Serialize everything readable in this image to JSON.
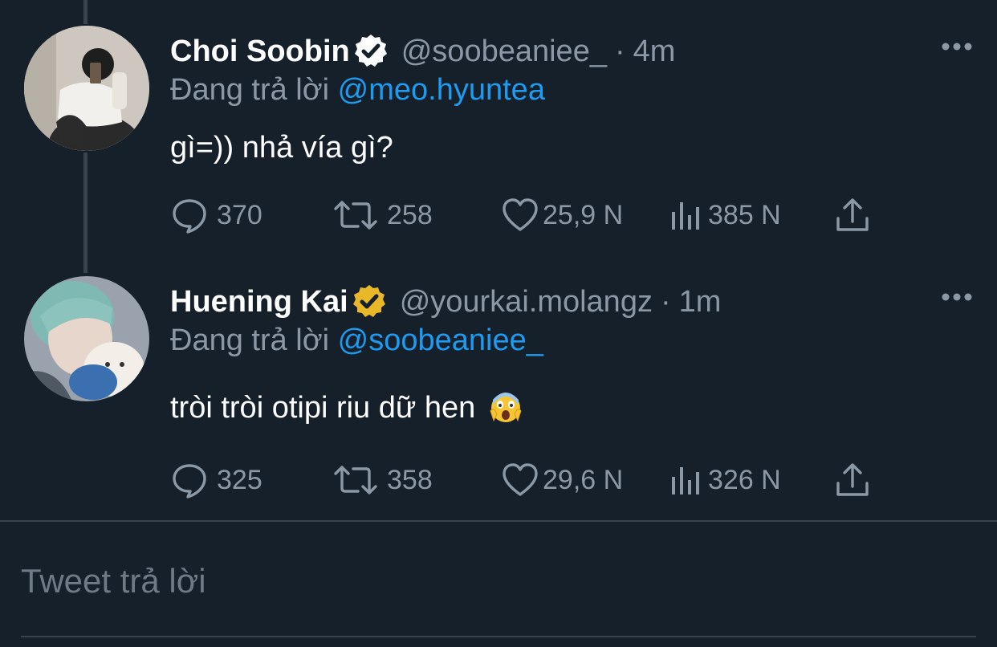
{
  "tweets": [
    {
      "display_name": "Choi Soobin",
      "verified_badge": "blue-check-badge",
      "handle": "@soobeaniee_",
      "separator": "·",
      "time": "4m",
      "replying_prefix": "Đang trả lời",
      "replying_to": "@meo.hyuntea",
      "text": "gì=)) nhả vía gì?",
      "stats": {
        "replies": "370",
        "retweets": "258",
        "likes": "25,9 N",
        "views": "385 N"
      }
    },
    {
      "display_name": "Huening Kai",
      "verified_badge": "gold-check-badge",
      "handle": "@yourkai.molangz",
      "separator": "·",
      "time": "1m",
      "replying_prefix": "Đang trả lời",
      "replying_to": "@soobeaniee_",
      "text": "tròi tròi otipi riu dữ hen",
      "emoji": "screaming-face-emoji",
      "stats": {
        "replies": "325",
        "retweets": "358",
        "likes": "29,6 N",
        "views": "326 N"
      }
    }
  ],
  "reply_box": {
    "placeholder": "Tweet trả lời"
  },
  "colors": {
    "background": "#15202b",
    "text_primary": "#ffffff",
    "text_secondary": "#8b98a5",
    "mention": "#1d9bf0",
    "divider": "#38444d",
    "badge_blue": "#ffffff",
    "badge_gold": "#e8b829"
  }
}
